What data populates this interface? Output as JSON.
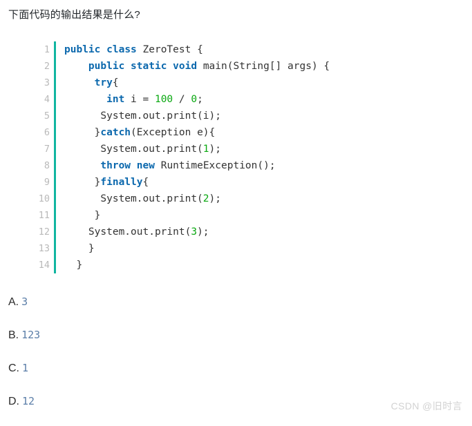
{
  "question": {
    "title": "下面代码的输出结果是什么?"
  },
  "code_block": {
    "language": "java",
    "gutter_rule_color": "#10b5a0",
    "keyword_color": "#0b68ad",
    "number_color": "#0aa811",
    "plain_color": "#333333",
    "line_number_color": "#b9b9b9",
    "lines": [
      {
        "number": "1",
        "tokens": [
          {
            "t": "public",
            "k": "kw"
          },
          {
            "t": " ",
            "k": "pln"
          },
          {
            "t": "class",
            "k": "kw"
          },
          {
            "t": " ZeroTest {",
            "k": "pln"
          }
        ]
      },
      {
        "number": "2",
        "tokens": [
          {
            "t": "    ",
            "k": "pln"
          },
          {
            "t": "public",
            "k": "kw"
          },
          {
            "t": " ",
            "k": "pln"
          },
          {
            "t": "static",
            "k": "kw"
          },
          {
            "t": " ",
            "k": "pln"
          },
          {
            "t": "void",
            "k": "kw"
          },
          {
            "t": " main(String[] args) {",
            "k": "pln"
          }
        ]
      },
      {
        "number": "3",
        "tokens": [
          {
            "t": "     ",
            "k": "pln"
          },
          {
            "t": "try",
            "k": "kw"
          },
          {
            "t": "{",
            "k": "pln"
          }
        ]
      },
      {
        "number": "4",
        "tokens": [
          {
            "t": "       ",
            "k": "pln"
          },
          {
            "t": "int",
            "k": "kw"
          },
          {
            "t": " i = ",
            "k": "pln"
          },
          {
            "t": "100",
            "k": "num"
          },
          {
            "t": " / ",
            "k": "pln"
          },
          {
            "t": "0",
            "k": "num"
          },
          {
            "t": ";",
            "k": "pln"
          }
        ]
      },
      {
        "number": "5",
        "tokens": [
          {
            "t": "      System.out.print(i);",
            "k": "pln"
          }
        ]
      },
      {
        "number": "6",
        "tokens": [
          {
            "t": "     }",
            "k": "pln"
          },
          {
            "t": "catch",
            "k": "kw"
          },
          {
            "t": "(Exception e){",
            "k": "pln"
          }
        ]
      },
      {
        "number": "7",
        "tokens": [
          {
            "t": "      System.out.print(",
            "k": "pln"
          },
          {
            "t": "1",
            "k": "num"
          },
          {
            "t": ");",
            "k": "pln"
          }
        ]
      },
      {
        "number": "8",
        "tokens": [
          {
            "t": "      ",
            "k": "pln"
          },
          {
            "t": "throw",
            "k": "kw"
          },
          {
            "t": " ",
            "k": "pln"
          },
          {
            "t": "new",
            "k": "kw"
          },
          {
            "t": " RuntimeException();",
            "k": "pln"
          }
        ]
      },
      {
        "number": "9",
        "tokens": [
          {
            "t": "     }",
            "k": "pln"
          },
          {
            "t": "finally",
            "k": "kw"
          },
          {
            "t": "{",
            "k": "pln"
          }
        ]
      },
      {
        "number": "10",
        "tokens": [
          {
            "t": "      System.out.print(",
            "k": "pln"
          },
          {
            "t": "2",
            "k": "num"
          },
          {
            "t": ");",
            "k": "pln"
          }
        ]
      },
      {
        "number": "11",
        "tokens": [
          {
            "t": "     }",
            "k": "pln"
          }
        ]
      },
      {
        "number": "12",
        "tokens": [
          {
            "t": "    System.out.print(",
            "k": "pln"
          },
          {
            "t": "3",
            "k": "num"
          },
          {
            "t": ");",
            "k": "pln"
          }
        ]
      },
      {
        "number": "13",
        "tokens": [
          {
            "t": "    }",
            "k": "pln"
          }
        ]
      },
      {
        "number": "14",
        "tokens": [
          {
            "t": "  }",
            "k": "pln"
          }
        ]
      }
    ]
  },
  "options": [
    {
      "letter": "A.",
      "value": "3"
    },
    {
      "letter": "B.",
      "value": "123"
    },
    {
      "letter": "C.",
      "value": "1"
    },
    {
      "letter": "D.",
      "value": "12"
    }
  ],
  "watermark": {
    "text": "CSDN @旧时言"
  }
}
